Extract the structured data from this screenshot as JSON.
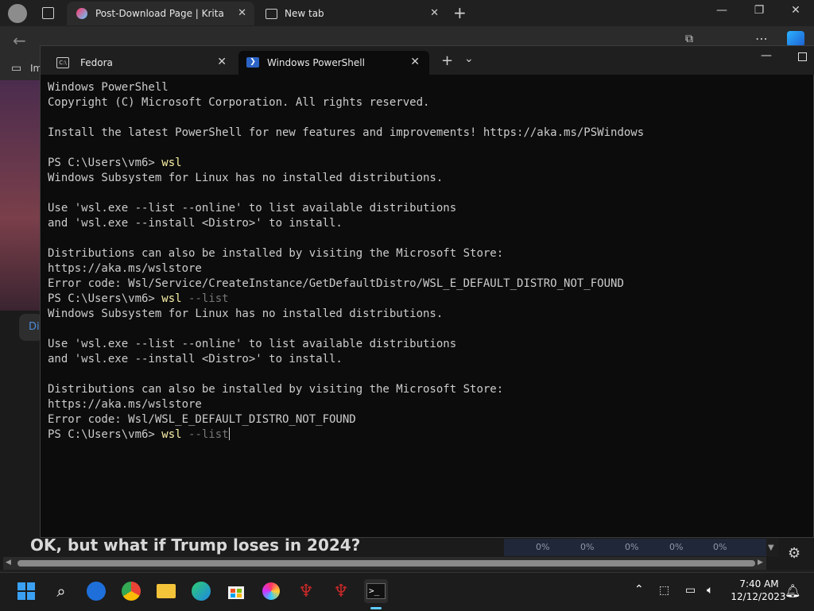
{
  "browser": {
    "tabs": [
      {
        "label": "Post-Download Page | Krita"
      },
      {
        "label": "New tab"
      }
    ],
    "favorites_partial": "Im",
    "page": {
      "left_card_partial": "Di",
      "headline": "OK, but what if Trump loses in 2024?",
      "stats": [
        "0%",
        "0%",
        "0%",
        "0%",
        "0%"
      ]
    }
  },
  "terminal": {
    "tabs": [
      {
        "label": "Fedora"
      },
      {
        "label": "Windows PowerShell"
      }
    ],
    "new_tab_symbol": "+",
    "dropdown_symbol": "⌄",
    "lines": [
      {
        "text": "Windows PowerShell"
      },
      {
        "text": "Copyright (C) Microsoft Corporation. All rights reserved."
      },
      {
        "text": ""
      },
      {
        "text": "Install the latest PowerShell for new features and improvements! https://aka.ms/PSWindows"
      },
      {
        "text": ""
      },
      {
        "prompt": "PS C:\\Users\\vm6> ",
        "cmd": "wsl",
        "arg": ""
      },
      {
        "text": "Windows Subsystem for Linux has no installed distributions."
      },
      {
        "text": ""
      },
      {
        "text": "Use 'wsl.exe --list --online' to list available distributions"
      },
      {
        "text": "and 'wsl.exe --install <Distro>' to install."
      },
      {
        "text": ""
      },
      {
        "text": "Distributions can also be installed by visiting the Microsoft Store:"
      },
      {
        "text": "https://aka.ms/wslstore"
      },
      {
        "text": "Error code: Wsl/Service/CreateInstance/GetDefaultDistro/WSL_E_DEFAULT_DISTRO_NOT_FOUND"
      },
      {
        "prompt": "PS C:\\Users\\vm6> ",
        "cmd": "wsl",
        "arg": " --list"
      },
      {
        "text": "Windows Subsystem for Linux has no installed distributions."
      },
      {
        "text": ""
      },
      {
        "text": "Use 'wsl.exe --list --online' to list available distributions"
      },
      {
        "text": "and 'wsl.exe --install <Distro>' to install."
      },
      {
        "text": ""
      },
      {
        "text": "Distributions can also be installed by visiting the Microsoft Store:"
      },
      {
        "text": "https://aka.ms/wslstore"
      },
      {
        "text": "Error code: Wsl/WSL_E_DEFAULT_DISTRO_NOT_FOUND"
      },
      {
        "prompt": "PS C:\\Users\\vm6> ",
        "cmd": "wsl",
        "arg": " --list",
        "cursor": true
      }
    ]
  },
  "taskbar": {
    "time": "7:40 AM",
    "date": "12/12/2023",
    "pinned": [
      "start-icon",
      "search-icon",
      "edge-beta-icon",
      "chrome-icon",
      "file-explorer-icon",
      "edge-icon",
      "microsoft-store-icon",
      "krita-icon",
      "quake-icon",
      "quake-icon",
      "terminal-icon"
    ]
  },
  "colors": {
    "terminal_bg": "#0c0c0c",
    "terminal_text": "#cccccc",
    "command": "#f9f1a5",
    "argument": "#767676"
  }
}
